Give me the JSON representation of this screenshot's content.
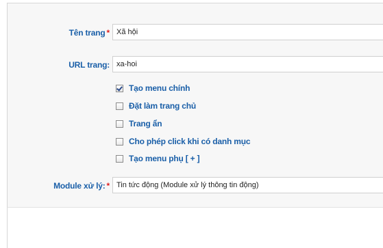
{
  "form": {
    "page_name": {
      "label": "Tên trang",
      "required_mark": "*",
      "value": "Xã hội"
    },
    "page_url": {
      "label": "URL trang:",
      "value": "xa-hoi"
    },
    "options": [
      {
        "label": "Tạo menu chính",
        "checked": true
      },
      {
        "label": "Đặt làm trang chủ",
        "checked": false
      },
      {
        "label": "Trang ẩn",
        "checked": false
      },
      {
        "label": "Cho phép click khi có danh mục",
        "checked": false
      },
      {
        "label": "Tạo menu phụ [ + ]",
        "checked": false
      }
    ],
    "module": {
      "label": "Module xử lý:",
      "required_mark": "*",
      "value": "Tin tức động (Module xử lý thông tin động)"
    }
  }
}
